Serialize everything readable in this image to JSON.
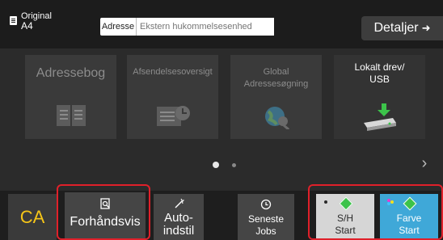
{
  "header": {
    "original_label": "Original",
    "original_size": "A4",
    "address_label": "Adresse",
    "address_placeholder": "Ekstern hukommelsesenhed",
    "details_label": "Detaljer"
  },
  "tiles": [
    {
      "label": "Adressebog",
      "enabled": false,
      "icon": "address-book-icon"
    },
    {
      "label": "Afsendelsesoversigt",
      "enabled": false,
      "icon": "send-history-icon"
    },
    {
      "label": "Global Adressesøgning",
      "enabled": false,
      "icon": "global-search-icon"
    },
    {
      "label": "Lokalt drev/ USB",
      "enabled": true,
      "icon": "usb-drive-icon"
    }
  ],
  "pager": {
    "current": 1,
    "total": 2
  },
  "bottom": {
    "ca_label": "CA",
    "preview_label": "Forhåndsvis",
    "auto_label_1": "Auto-",
    "auto_label_2": "indstil",
    "recent_label_1": "Seneste",
    "recent_label_2": "Jobs",
    "bw_label_1": "S/H",
    "bw_label_2": "Start",
    "color_label_1": "Farve",
    "color_label_2": "Start"
  },
  "colors": {
    "highlight": "#e0202a",
    "color_start": "#3fa8d8",
    "ca_text": "#f5c518"
  }
}
